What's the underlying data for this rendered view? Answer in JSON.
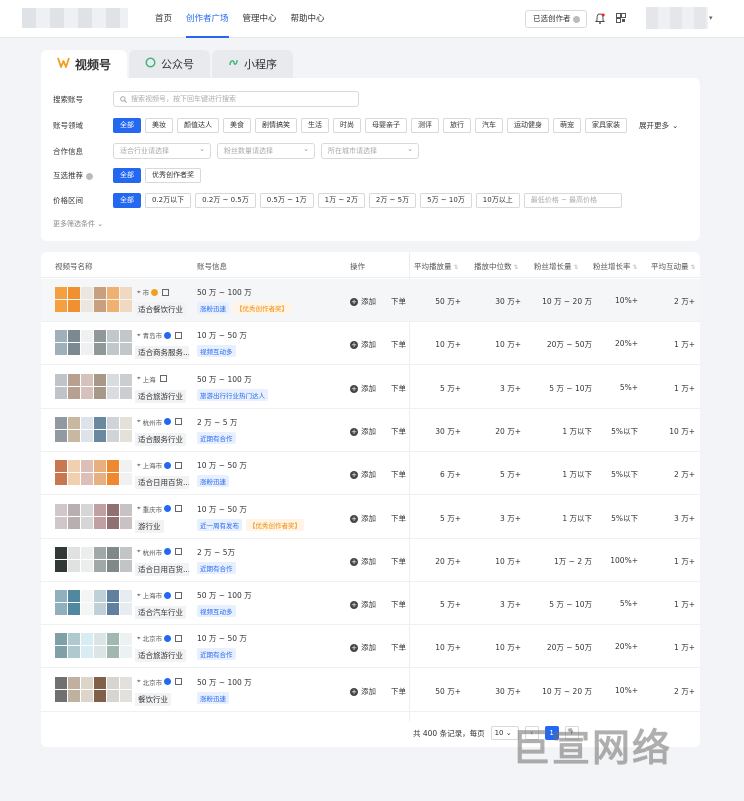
{
  "nav": {
    "items": [
      "首页",
      "创作者广场",
      "管理中心",
      "帮助中心"
    ],
    "active": 1
  },
  "header": {
    "selected_label": "已选创作者",
    "user_sub": "ID"
  },
  "tabs": [
    {
      "label": "视频号",
      "icon": "video-channel-icon"
    },
    {
      "label": "公众号",
      "icon": "official-account-icon"
    },
    {
      "label": "小程序",
      "icon": "mini-program-icon"
    }
  ],
  "filters": {
    "search_label": "搜索账号",
    "search_placeholder": "搜索视频号，按下回车键进行搜索",
    "domain_label": "账号领域",
    "domains": [
      "全部",
      "美妆",
      "颜值达人",
      "美食",
      "剧情搞笑",
      "生活",
      "时尚",
      "母婴亲子",
      "测评",
      "旅行",
      "汽车",
      "运动健身",
      "萌宠",
      "家具家装"
    ],
    "expand_more": "展开更多",
    "coop_label": "合作信息",
    "coop_selects": [
      "适合行业请选择",
      "粉丝数量请选择",
      "所在城市请选择"
    ],
    "recommend_label": "互选推荐",
    "recommends": [
      "全部",
      "优秀创作者奖"
    ],
    "price_label": "价格区间",
    "prices": [
      "全部",
      "0.2万以下",
      "0.2万 ~ 0.5万",
      "0.5万 ~ 1万",
      "1万 ~ 2万",
      "2万 ~ 5万",
      "5万 ~ 10万",
      "10万以上"
    ],
    "price_range_placeholder": "最低价格 ~ 最高价格",
    "more_conditions": "更多筛选条件"
  },
  "table": {
    "headers": [
      "视频号名称",
      "账号信息",
      "操作",
      "平均播放量",
      "播放中位数",
      "粉丝增长量",
      "粉丝增长率",
      "平均互动量"
    ],
    "add_label": "添加",
    "order_label": "下单",
    "rows": [
      {
        "loc": "市",
        "badge": "gold",
        "industry": "适合餐饮行业",
        "fans": "50 万 ~ 100 万",
        "tags": [
          {
            "t": "涨粉迅速",
            "c": "blue"
          },
          {
            "t": "【优秀创作者奖】",
            "c": "orange"
          }
        ],
        "vals": [
          "50 万+",
          "30 万+",
          "10 万 ~ 20 万",
          "10%+",
          "2 万+"
        ]
      },
      {
        "loc": "青岛市",
        "badge": "blue",
        "industry": "适合商务服务...",
        "fans": "10 万 ~ 50 万",
        "tags": [
          {
            "t": "视频互动多",
            "c": "blue"
          }
        ],
        "vals": [
          "10 万+",
          "10 万+",
          "20万 ~ 50万",
          "20%+",
          "1 万+"
        ]
      },
      {
        "loc": "上海",
        "badge": "none",
        "industry": "适合旅游行业",
        "fans": "50 万 ~ 100 万",
        "tags": [
          {
            "t": "旅游出行行业热门达人",
            "c": "blue"
          }
        ],
        "vals": [
          "5 万+",
          "3 万+",
          "5 万 ~ 10万",
          "5%+",
          "1 万+"
        ]
      },
      {
        "loc": "杭州市",
        "badge": "blue",
        "industry": "适合服务行业",
        "fans": "2 万 ~ 5 万",
        "tags": [
          {
            "t": "近期有合作",
            "c": "blue"
          }
        ],
        "vals": [
          "30 万+",
          "20 万+",
          "1 万以下",
          "5%以下",
          "10 万+"
        ]
      },
      {
        "loc": "上海市",
        "badge": "blue",
        "industry": "适合日用百货...",
        "fans": "10 万 ~ 50 万",
        "tags": [
          {
            "t": "涨粉迅速",
            "c": "blue"
          }
        ],
        "vals": [
          "6 万+",
          "5 万+",
          "1 万以下",
          "5%以下",
          "2 万+"
        ]
      },
      {
        "loc": "重庆市",
        "badge": "blue",
        "industry": "游行业",
        "fans": "10 万 ~ 50 万",
        "tags": [
          {
            "t": "近一周有发布",
            "c": "blue"
          },
          {
            "t": "【优秀创作者奖】",
            "c": "orange"
          }
        ],
        "vals": [
          "5 万+",
          "3 万+",
          "1 万以下",
          "5%以下",
          "3 万+"
        ]
      },
      {
        "loc": "杭州市",
        "badge": "blue",
        "industry": "适合日用百货...",
        "fans": "2 万 ~ 5万",
        "tags": [
          {
            "t": "近期有合作",
            "c": "blue"
          }
        ],
        "vals": [
          "20 万+",
          "10 万+",
          "1万 ~ 2 万",
          "100%+",
          "1 万+"
        ]
      },
      {
        "loc": "上海市",
        "badge": "blue",
        "industry": "适合汽车行业",
        "fans": "50 万 ~ 100 万",
        "tags": [
          {
            "t": "视频互动多",
            "c": "blue"
          }
        ],
        "vals": [
          "5 万+",
          "3 万+",
          "5 万 ~ 10万",
          "5%+",
          "1 万+"
        ]
      },
      {
        "loc": "北京市",
        "badge": "blue",
        "industry": "适合旅游行业",
        "fans": "10 万 ~ 50 万",
        "tags": [
          {
            "t": "近期有合作",
            "c": "blue"
          }
        ],
        "vals": [
          "10 万+",
          "10 万+",
          "20万 ~ 50万",
          "20%+",
          "1 万+"
        ]
      },
      {
        "loc": "北京市",
        "badge": "blue",
        "industry": "餐饮行业",
        "fans": "50 万 ~ 100 万",
        "tags": [
          {
            "t": "涨粉迅速",
            "c": "blue"
          }
        ],
        "vals": [
          "50 万+",
          "30 万+",
          "10 万 ~ 20 万",
          "10%+",
          "2 万+"
        ]
      }
    ]
  },
  "pager": {
    "total": "共 400 条记录，每页",
    "page_size": "10"
  },
  "watermark": "巨宣网络"
}
